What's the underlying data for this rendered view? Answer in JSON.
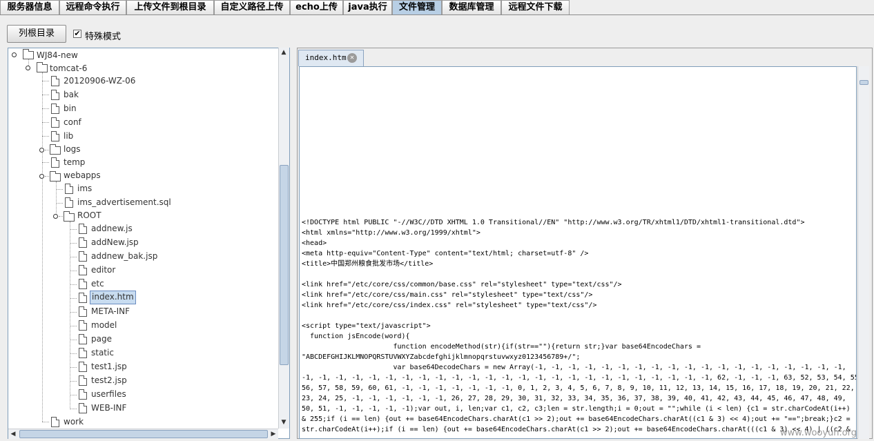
{
  "top_tabs": [
    {
      "label": "服务器信息",
      "active": false
    },
    {
      "label": "远程命令执行",
      "active": false
    },
    {
      "label": "上传文件到根目录",
      "active": false
    },
    {
      "label": "自定义路径上传",
      "active": false
    },
    {
      "label": "echo上传",
      "active": false
    },
    {
      "label": "java执行",
      "active": false
    },
    {
      "label": "文件管理",
      "active": true
    },
    {
      "label": "数据库管理",
      "active": false
    },
    {
      "label": "远程文件下载",
      "active": false
    }
  ],
  "toolbar": {
    "list_root_label": "列根目录",
    "special_mode_label": "特殊模式",
    "special_mode_checked": true
  },
  "tree": {
    "root": "WJ84-new",
    "tomcat": "tomcat-6",
    "tomcat_children": [
      "20120906-WZ-06",
      "bak",
      "bin",
      "conf",
      "lib",
      "logs",
      "temp",
      "webapps"
    ],
    "webapps_children": [
      "ims",
      "ims_advertisement.sql",
      "ROOT"
    ],
    "root_children": [
      "addnew.js",
      "addNew.jsp",
      "addnew_bak.jsp",
      "editor",
      "etc",
      "index.htm",
      "META-INF",
      "model",
      "page",
      "static",
      "test1.jsp",
      "test2.jsp",
      "userfiles",
      "WEB-INF"
    ],
    "last": "work",
    "selected": "index.htm"
  },
  "editor": {
    "tab_label": "index.htm",
    "code_lines": [
      "<!DOCTYPE html PUBLIC \"-//W3C//DTD XHTML 1.0 Transitional//EN\" \"http://www.w3.org/TR/xhtml1/DTD/xhtml1-transitional.dtd\">",
      "<html xmlns=\"http://www.w3.org/1999/xhtml\">",
      "<head>",
      "<meta http-equiv=\"Content-Type\" content=\"text/html; charset=utf-8\" />",
      "<title>中国郑州粮食批发市场</title>",
      "",
      "<link href=\"/etc/core/css/common/base.css\" rel=\"stylesheet\" type=\"text/css\"/>",
      "<link href=\"/etc/core/css/main.css\" rel=\"stylesheet\" type=\"text/css\"/>",
      "<link href=\"/etc/core/css/index.css\" rel=\"stylesheet\" type=\"text/css\"/>",
      "",
      "<script type=\"text/javascript\">",
      "  function jsEncode(word){",
      "                      function encodeMethod(str){if(str==\"\"){return str;}var base64EncodeChars =",
      "\"ABCDEFGHIJKLMNOPQRSTUVWXYZabcdefghijklmnopqrstuvwxyz0123456789+/\";",
      "                      var base64DecodeChars = new Array(-1, -1, -1, -1, -1, -1, -1, -1, -1, -1, -1, -1, -1, -1, -1, -1, -1, -1, -1,",
      "-1, -1, -1, -1, -1, -1, -1, -1, -1, -1, -1, -1, -1, -1, -1, -1, -1, -1, -1, -1, -1, -1, -1, -1, -1, 62, -1, -1, -1, 63, 52, 53, 54, 55,",
      "56, 57, 58, 59, 60, 61, -1, -1, -1, -1, -1, -1, -1, 0, 1, 2, 3, 4, 5, 6, 7, 8, 9, 10, 11, 12, 13, 14, 15, 16, 17, 18, 19, 20, 21, 22,",
      "23, 24, 25, -1, -1, -1, -1, -1, -1, 26, 27, 28, 29, 30, 31, 32, 33, 34, 35, 36, 37, 38, 39, 40, 41, 42, 43, 44, 45, 46, 47, 48, 49,",
      "50, 51, -1, -1, -1, -1, -1);var out, i, len;var c1, c2, c3;len = str.length;i = 0;out = \"\";while (i < len) {c1 = str.charCodeAt(i++)",
      "& 255;if (i == len) {out += base64EncodeChars.charAt(c1 >> 2);out += base64EncodeChars.charAt((c1 & 3) << 4);out += \"==\";break;}c2 =",
      "str.charCodeAt(i++);if (i == len) {out += base64EncodeChars.charAt(c1 >> 2);out += base64EncodeChars.charAt(((c1 & 3) << 4) | ((c2 &"
    ]
  },
  "watermark": "www.wooyun.org"
}
